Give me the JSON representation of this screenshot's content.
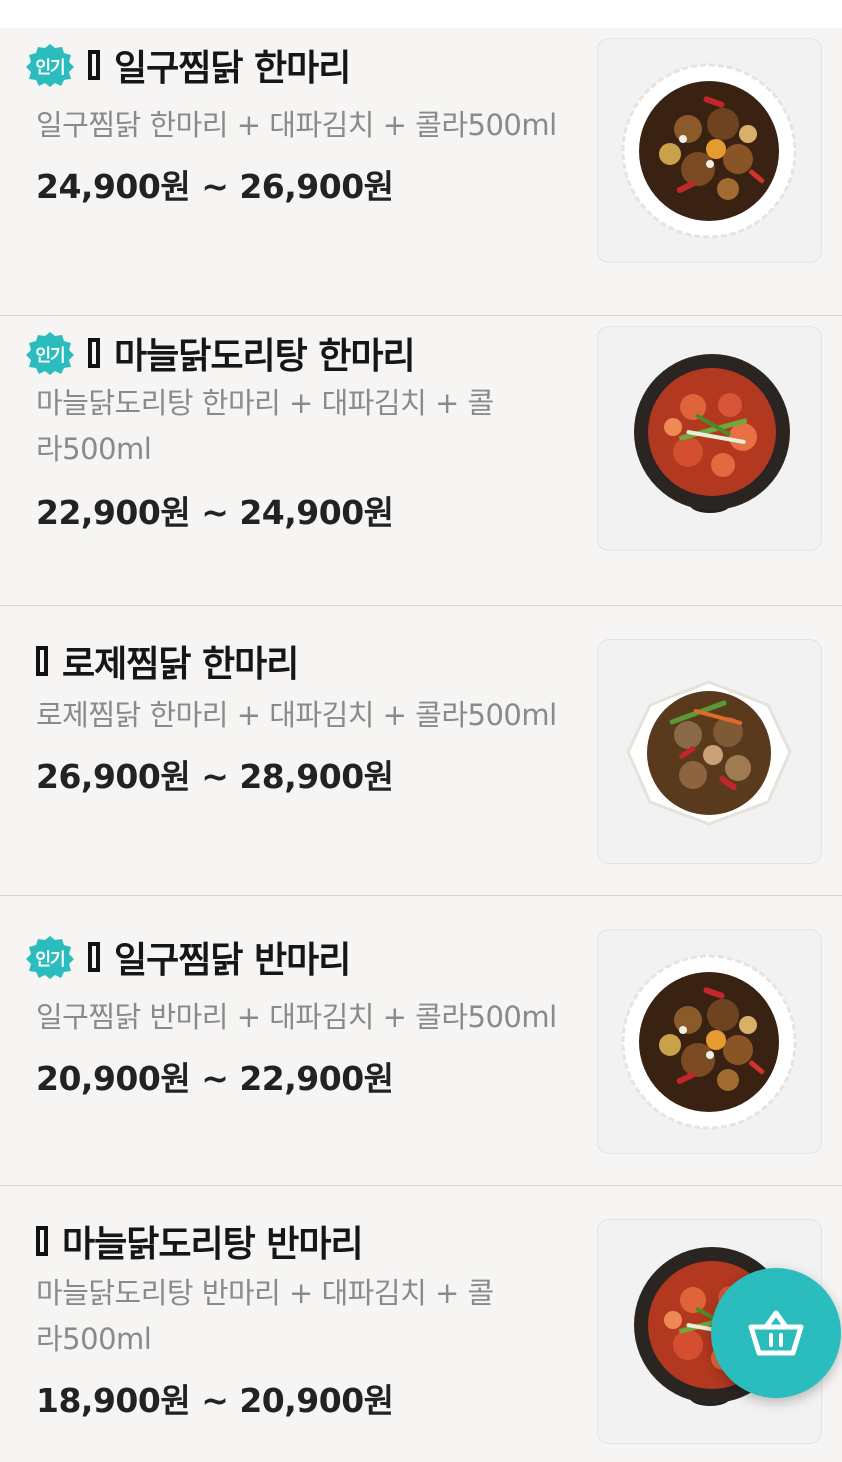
{
  "menu": {
    "items": [
      {
        "badge": "인기",
        "name": "일구찜닭 한마리",
        "desc": "일구찜닭 한마리 + 대파김치 +  콜라500ml",
        "price": "24,900원 ~ 26,900원",
        "image": "jjimdak-white-plate"
      },
      {
        "badge": "인기",
        "name": "마늘닭도리탕 한마리",
        "desc": "마늘닭도리탕 한마리 +  대파김치 + 콜라500ml",
        "price": "22,900원 ~ 24,900원",
        "image": "dakdoritang-black-pot"
      },
      {
        "badge": "",
        "name": "로제찜닭 한마리",
        "desc": "로제찜닭 한마리 + 대파김치 + 콜라500ml",
        "price": "26,900원 ~ 28,900원",
        "image": "rose-jjimdak-white-bowl"
      },
      {
        "badge": "인기",
        "name": "일구찜닭 반마리",
        "desc": "일구찜닭 반마리 + 대파김치 + 콜라500ml",
        "price": "20,900원 ~ 22,900원",
        "image": "jjimdak-white-plate"
      },
      {
        "badge": "",
        "name": "마늘닭도리탕 반마리",
        "desc": "마늘닭도리탕 반마리 + 대파김치 + 콜라500ml",
        "price": "18,900원 ~ 20,900원",
        "image": "dakdoritang-black-pot"
      }
    ]
  },
  "cart_button": {
    "icon": "basket-icon"
  },
  "colors": {
    "accent": "#2bbdbd",
    "divider": "#e2d6c4",
    "left_rule": "#c7a97c"
  }
}
